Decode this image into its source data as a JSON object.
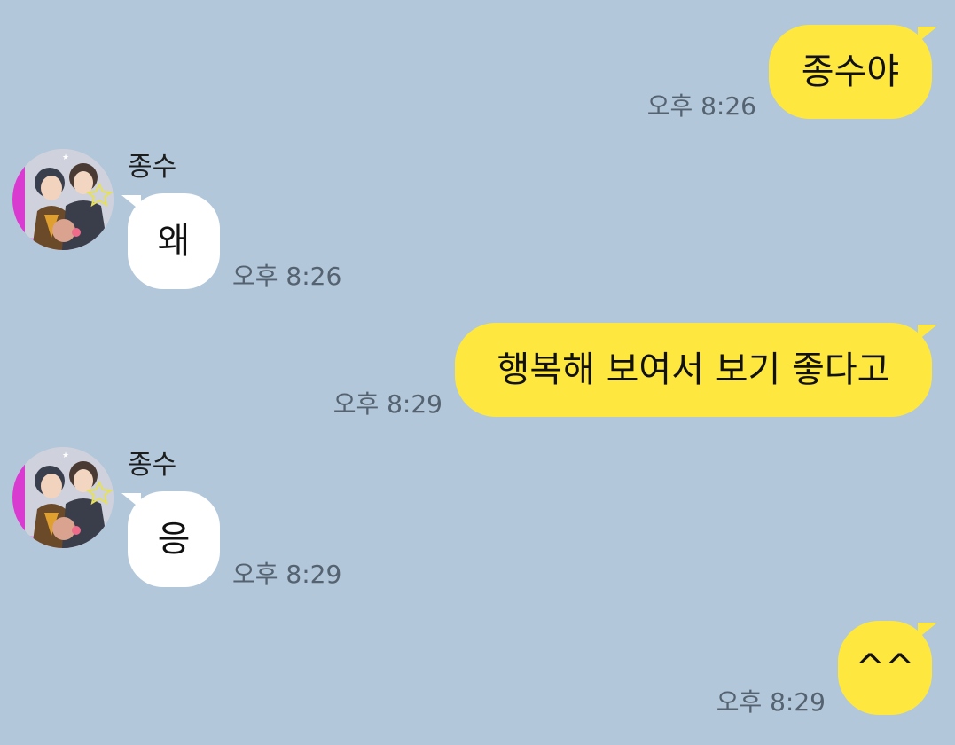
{
  "friend": {
    "name": "종수",
    "avatar_icon": "profile-photo-icon"
  },
  "colors": {
    "background": "#b2c7da",
    "my_bubble": "#fee83f",
    "friend_bubble": "#ffffff",
    "timestamp": "#556270"
  },
  "messages": [
    {
      "from": "me",
      "text": "종수야",
      "time": "오후 8:26"
    },
    {
      "from": "friend",
      "sender": "종수",
      "text": "왜",
      "time": "오후 8:26"
    },
    {
      "from": "me",
      "text": "행복해 보여서 보기 좋다고",
      "time": "오후 8:29"
    },
    {
      "from": "friend",
      "sender": "종수",
      "text": "응",
      "time": "오후 8:29"
    },
    {
      "from": "me",
      "text": "^^",
      "time": "오후 8:29"
    }
  ]
}
